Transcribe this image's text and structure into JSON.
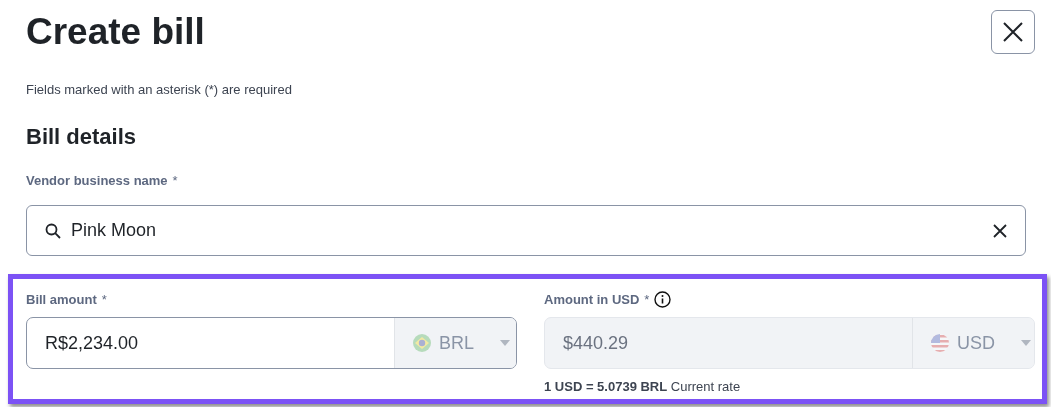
{
  "title": "Create bill",
  "required_note": "Fields marked with an asterisk (*) are required",
  "section_title": "Bill details",
  "vendor": {
    "label": "Vendor business name",
    "required_mark": "*",
    "value": "Pink Moon"
  },
  "amount_fields": [
    {
      "label": "Bill amount",
      "required_mark": "*",
      "info": false,
      "value": "R$2,234.00",
      "currency": "BRL",
      "disabled": false
    },
    {
      "label": "Amount in USD",
      "required_mark": "*",
      "info": true,
      "value": "$440.29",
      "currency": "USD",
      "disabled": true
    }
  ],
  "rate": "**1 USD = 5.0739 BRL** Current rate"
}
